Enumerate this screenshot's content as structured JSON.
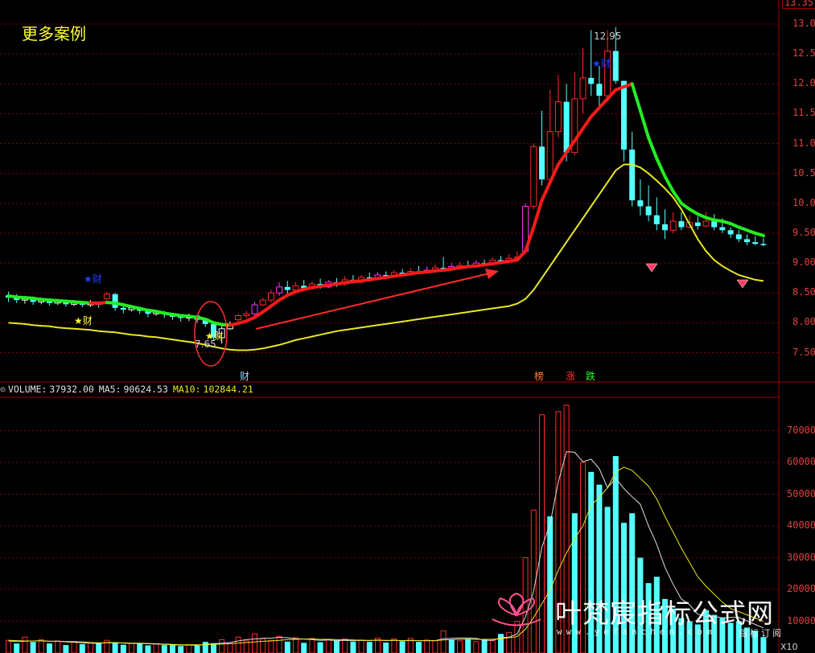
{
  "title": "更多案例",
  "price_axis": {
    "top_label": "13.35",
    "ticks": [
      "13.00",
      "12.50",
      "12.00",
      "11.50",
      "11.00",
      "10.50",
      "10.00",
      "9.50",
      "9.00",
      "8.50",
      "8.00",
      "7.50"
    ],
    "tick_values": [
      13.0,
      12.5,
      12.0,
      11.5,
      11.0,
      10.5,
      10.0,
      9.5,
      9.0,
      8.5,
      8.0,
      7.5
    ]
  },
  "volume_axis": {
    "ticks": [
      "70000",
      "60000",
      "50000",
      "40000",
      "30000",
      "20000",
      "10000"
    ],
    "tick_values": [
      70000,
      60000,
      50000,
      40000,
      30000,
      20000,
      10000
    ],
    "unit_label": "X10"
  },
  "annotations": {
    "high_label": "12.95",
    "low_label": "7.65",
    "cai_markers": [
      "★财",
      "★财"
    ],
    "cai_blue": [
      "★财",
      "★财"
    ],
    "cai_bottom": "财",
    "bottom_tags": [
      "榜",
      "涨",
      "跌"
    ]
  },
  "volume_header": {
    "name": "VOLUME:",
    "volume": "37932.00",
    "ma5_label": "MA5:",
    "ma5": "90624.53",
    "ma10_label": "MA10:",
    "ma10": "102844.21"
  },
  "watermark": {
    "brand": "叶梵宸指标公式网",
    "url": "www.yefanchen.com",
    "sub": "指标订阅"
  },
  "colors": {
    "up": "#ff2a2a",
    "down": "#54ffff",
    "ma_red": "#ff1a1a",
    "ma_green": "#22ee22",
    "ma_yellow": "#e8e821",
    "grid": "#7a0000",
    "axis_text": "#e04040"
  },
  "chart_data": [
    {
      "type": "candlestick",
      "title": "",
      "ylim": [
        7.2,
        13.35
      ],
      "candles": [
        [
          8.46,
          8.42,
          8.52,
          8.35
        ],
        [
          8.42,
          8.38,
          8.48,
          8.33
        ],
        [
          8.38,
          8.4,
          8.45,
          8.32
        ],
        [
          8.4,
          8.35,
          8.44,
          8.3
        ],
        [
          8.35,
          8.38,
          8.42,
          8.31
        ],
        [
          8.38,
          8.33,
          8.41,
          8.29
        ],
        [
          8.33,
          8.36,
          8.4,
          8.3
        ],
        [
          8.36,
          8.31,
          8.39,
          8.27
        ],
        [
          8.31,
          8.34,
          8.38,
          8.28
        ],
        [
          8.34,
          8.3,
          8.37,
          8.26
        ],
        [
          8.3,
          8.34,
          8.38,
          8.27
        ],
        [
          8.34,
          8.3,
          8.36,
          8.25
        ],
        [
          8.4,
          8.48,
          8.52,
          8.38
        ],
        [
          8.48,
          8.25,
          8.5,
          8.2
        ],
        [
          8.25,
          8.22,
          8.28,
          8.16
        ],
        [
          8.22,
          8.25,
          8.29,
          8.19
        ],
        [
          8.25,
          8.2,
          8.27,
          8.15
        ],
        [
          8.2,
          8.15,
          8.22,
          8.09
        ],
        [
          8.15,
          8.18,
          8.22,
          8.12
        ],
        [
          8.18,
          8.14,
          8.2,
          8.08
        ],
        [
          8.14,
          8.1,
          8.16,
          8.05
        ],
        [
          8.1,
          8.08,
          8.13,
          8.02
        ],
        [
          8.08,
          8.12,
          8.15,
          8.03
        ],
        [
          8.12,
          8.05,
          8.14,
          8.0
        ],
        [
          8.05,
          7.98,
          8.08,
          7.93
        ],
        [
          7.98,
          7.75,
          8.0,
          7.7
        ],
        [
          7.75,
          7.9,
          7.95,
          7.65
        ],
        [
          7.9,
          7.98,
          8.02,
          7.88
        ],
        [
          8.05,
          8.12,
          8.15,
          8.02
        ],
        [
          8.12,
          8.15,
          8.2,
          8.08
        ],
        [
          8.15,
          8.3,
          8.35,
          8.12
        ],
        [
          8.3,
          8.38,
          8.42,
          8.28
        ],
        [
          8.38,
          8.5,
          8.55,
          8.34
        ],
        [
          8.5,
          8.6,
          8.68,
          8.45
        ],
        [
          8.6,
          8.55,
          8.7,
          8.48
        ],
        [
          8.55,
          8.62,
          8.68,
          8.5
        ],
        [
          8.62,
          8.58,
          8.72,
          8.55
        ],
        [
          8.58,
          8.65,
          8.7,
          8.55
        ],
        [
          8.65,
          8.6,
          8.74,
          8.57
        ],
        [
          8.6,
          8.68,
          8.72,
          8.58
        ],
        [
          8.68,
          8.65,
          8.75,
          8.6
        ],
        [
          8.65,
          8.72,
          8.78,
          8.62
        ],
        [
          8.72,
          8.7,
          8.8,
          8.66
        ],
        [
          8.7,
          8.76,
          8.8,
          8.66
        ],
        [
          8.76,
          8.74,
          8.84,
          8.7
        ],
        [
          8.74,
          8.8,
          8.85,
          8.72
        ],
        [
          8.8,
          8.78,
          8.86,
          8.74
        ],
        [
          8.78,
          8.84,
          8.88,
          8.76
        ],
        [
          8.84,
          8.82,
          8.9,
          8.78
        ],
        [
          8.82,
          8.86,
          8.92,
          8.8
        ],
        [
          8.86,
          8.85,
          8.95,
          8.82
        ],
        [
          8.85,
          8.88,
          8.94,
          8.83
        ],
        [
          8.88,
          8.92,
          8.98,
          8.85
        ],
        [
          8.92,
          8.9,
          9.1,
          8.86
        ],
        [
          8.9,
          8.94,
          9.0,
          8.87
        ],
        [
          8.94,
          8.96,
          9.02,
          8.9
        ],
        [
          8.96,
          8.95,
          9.04,
          8.92
        ],
        [
          8.95,
          9.0,
          9.05,
          8.93
        ],
        [
          9.0,
          8.98,
          9.06,
          8.95
        ],
        [
          8.98,
          9.05,
          9.1,
          8.96
        ],
        [
          9.05,
          9.02,
          9.12,
          8.98
        ],
        [
          9.02,
          9.08,
          9.15,
          9.0
        ],
        [
          9.08,
          9.1,
          9.2,
          9.04
        ],
        [
          9.2,
          9.95,
          10.0,
          9.15
        ],
        [
          9.95,
          10.95,
          11.0,
          9.9
        ],
        [
          10.95,
          10.4,
          11.55,
          10.3
        ],
        [
          10.4,
          11.2,
          11.9,
          10.35
        ],
        [
          11.2,
          11.7,
          12.15,
          11.1
        ],
        [
          11.7,
          10.85,
          12.0,
          10.7
        ],
        [
          10.85,
          11.75,
          12.2,
          10.8
        ],
        [
          11.75,
          12.1,
          12.6,
          11.5
        ],
        [
          12.1,
          12.0,
          12.9,
          11.8
        ],
        [
          12.0,
          11.8,
          12.3,
          11.6
        ],
        [
          11.8,
          12.55,
          12.9,
          11.7
        ],
        [
          12.55,
          12.05,
          12.95,
          12.0
        ],
        [
          12.05,
          10.9,
          12.05,
          10.7
        ],
        [
          10.9,
          10.05,
          11.2,
          9.95
        ],
        [
          10.05,
          9.95,
          10.4,
          9.8
        ],
        [
          9.95,
          9.8,
          10.3,
          9.7
        ],
        [
          9.8,
          9.65,
          10.1,
          9.55
        ],
        [
          9.65,
          9.55,
          9.9,
          9.4
        ],
        [
          9.55,
          9.7,
          9.85,
          9.5
        ],
        [
          9.7,
          9.6,
          9.85,
          9.55
        ],
        [
          9.6,
          9.68,
          9.8,
          9.58
        ],
        [
          9.68,
          9.62,
          9.78,
          9.56
        ],
        [
          9.62,
          9.7,
          9.85,
          9.6
        ],
        [
          9.7,
          9.6,
          9.82,
          9.55
        ],
        [
          9.6,
          9.55,
          9.75,
          9.5
        ],
        [
          9.55,
          9.48,
          9.6,
          9.42
        ],
        [
          9.48,
          9.4,
          9.55,
          9.35
        ],
        [
          9.4,
          9.35,
          9.48,
          9.3
        ],
        [
          9.35,
          9.32,
          9.45,
          9.3
        ],
        [
          9.32,
          9.3,
          9.42,
          9.28
        ]
      ],
      "ma_fast": [
        8.45,
        8.43,
        8.42,
        8.41,
        8.39,
        8.38,
        8.37,
        8.36,
        8.35,
        8.34,
        8.33,
        8.33,
        8.34,
        8.33,
        8.3,
        8.27,
        8.24,
        8.21,
        8.19,
        8.16,
        8.14,
        8.12,
        8.11,
        8.09,
        8.06,
        8.0,
        7.97,
        7.96,
        7.99,
        8.03,
        8.09,
        8.18,
        8.28,
        8.38,
        8.46,
        8.52,
        8.56,
        8.59,
        8.61,
        8.63,
        8.65,
        8.67,
        8.69,
        8.7,
        8.72,
        8.74,
        8.76,
        8.78,
        8.8,
        8.82,
        8.84,
        8.85,
        8.87,
        8.88,
        8.9,
        8.92,
        8.94,
        8.95,
        8.97,
        8.99,
        9.01,
        9.03,
        9.05,
        9.2,
        9.6,
        10.05,
        10.35,
        10.65,
        10.85,
        11.05,
        11.25,
        11.45,
        11.6,
        11.75,
        11.9,
        11.95,
        12.0,
        11.55,
        11.1,
        10.75,
        10.45,
        10.2,
        10.0,
        9.9,
        9.82,
        9.76,
        9.72,
        9.7,
        9.66,
        9.6,
        9.55,
        9.5,
        9.46
      ],
      "ma_slow": [
        8.0,
        7.99,
        7.98,
        7.96,
        7.95,
        7.94,
        7.92,
        7.91,
        7.9,
        7.89,
        7.88,
        7.86,
        7.85,
        7.84,
        7.82,
        7.8,
        7.79,
        7.77,
        7.76,
        7.74,
        7.72,
        7.7,
        7.68,
        7.66,
        7.63,
        7.6,
        7.57,
        7.55,
        7.54,
        7.54,
        7.55,
        7.57,
        7.6,
        7.63,
        7.67,
        7.71,
        7.74,
        7.77,
        7.8,
        7.83,
        7.86,
        7.88,
        7.9,
        7.92,
        7.94,
        7.96,
        7.98,
        8.0,
        8.02,
        8.04,
        8.06,
        8.08,
        8.1,
        8.12,
        8.14,
        8.16,
        8.18,
        8.2,
        8.22,
        8.24,
        8.26,
        8.28,
        8.32,
        8.4,
        8.55,
        8.75,
        8.95,
        9.15,
        9.35,
        9.55,
        9.75,
        9.95,
        10.15,
        10.35,
        10.55,
        10.65,
        10.65,
        10.6,
        10.5,
        10.38,
        10.25,
        10.1,
        9.9,
        9.65,
        9.4,
        9.2,
        9.05,
        8.95,
        8.87,
        8.8,
        8.76,
        8.72,
        8.7
      ]
    },
    {
      "type": "bar",
      "title": "VOLUME",
      "ylim": [
        0,
        80000
      ],
      "values": [
        4000,
        3000,
        5000,
        3500,
        4200,
        3000,
        3800,
        2500,
        3600,
        2800,
        3200,
        3100,
        4000,
        3400,
        2600,
        3000,
        2900,
        2400,
        2800,
        2500,
        2700,
        2200,
        2600,
        2300,
        3500,
        3100,
        4200,
        3000,
        5000,
        3800,
        6000,
        4500,
        4000,
        5200,
        3600,
        4800,
        3200,
        4600,
        3400,
        4300,
        3800,
        4400,
        3600,
        4100,
        3500,
        4700,
        3300,
        4400,
        3700,
        4600,
        3500,
        4100,
        3900,
        7000,
        4200,
        3800,
        4500,
        3600,
        4300,
        3900,
        6000,
        6500,
        10000,
        30000,
        45000,
        75000,
        43000,
        76000,
        78000,
        44000,
        60000,
        57000,
        53000,
        46000,
        62000,
        41000,
        44000,
        30000,
        22000,
        24000,
        17000,
        14000,
        11000,
        10000,
        9000,
        13500,
        12000,
        11000,
        9500,
        10000,
        8000,
        7000,
        5000
      ],
      "down_flags": [
        0,
        1,
        0,
        1,
        0,
        1,
        0,
        1,
        0,
        1,
        0,
        1,
        0,
        1,
        1,
        0,
        1,
        1,
        0,
        1,
        1,
        1,
        0,
        1,
        1,
        1,
        0,
        0,
        0,
        0,
        0,
        0,
        0,
        0,
        1,
        0,
        1,
        0,
        1,
        0,
        1,
        0,
        1,
        0,
        1,
        0,
        1,
        0,
        1,
        0,
        1,
        0,
        0,
        0,
        1,
        0,
        1,
        0,
        1,
        0,
        1,
        0,
        0,
        0,
        0,
        0,
        1,
        0,
        0,
        1,
        0,
        1,
        1,
        1,
        1,
        1,
        1,
        1,
        1,
        1,
        1,
        1,
        1,
        1,
        1,
        1,
        1,
        1,
        1,
        1,
        1,
        1,
        1
      ],
      "ma5": [
        3800,
        3600,
        3700,
        3800,
        3900,
        3700,
        3700,
        3500,
        3400,
        3200,
        3100,
        3000,
        3300,
        3300,
        3100,
        3000,
        3000,
        2900,
        2800,
        2700,
        2600,
        2500,
        2500,
        2400,
        2700,
        2900,
        3100,
        3300,
        3800,
        4200,
        4400,
        4600,
        4700,
        4900,
        4800,
        4500,
        4400,
        4200,
        4000,
        4100,
        3900,
        4000,
        3900,
        4000,
        3900,
        4100,
        3900,
        4000,
        3900,
        4000,
        3900,
        3900,
        3900,
        4500,
        4600,
        4700,
        4700,
        4600,
        4000,
        4000,
        4800,
        5000,
        6000,
        11400,
        19500,
        33300,
        40600,
        53800,
        63400,
        63200,
        60200,
        61000,
        58000,
        52000,
        55000,
        51800,
        49200,
        46800,
        40000,
        34200,
        27000,
        21600,
        17000,
        15200,
        12200,
        11500,
        11500,
        11100,
        11200,
        11200,
        10100,
        9000,
        7900
      ],
      "ma10": [
        4000,
        3900,
        3800,
        3800,
        3800,
        3700,
        3700,
        3600,
        3600,
        3500,
        3300,
        3200,
        3200,
        3200,
        3200,
        3100,
        3100,
        3000,
        2900,
        2800,
        2700,
        2600,
        2600,
        2600,
        2600,
        2700,
        2800,
        2900,
        3100,
        3300,
        3500,
        3700,
        3800,
        4000,
        4200,
        4300,
        4400,
        4400,
        4300,
        4300,
        4200,
        4200,
        4100,
        4000,
        4000,
        4000,
        4000,
        4000,
        3900,
        3900,
        3900,
        3900,
        3900,
        4100,
        4200,
        4300,
        4300,
        4300,
        4300,
        4300,
        4500,
        4800,
        5200,
        7500,
        11200,
        15500,
        19800,
        26000,
        31500,
        36000,
        40000,
        46500,
        49000,
        52000,
        57000,
        58500,
        57500,
        55000,
        52500,
        48500,
        43000,
        38000,
        33000,
        28500,
        24000,
        21000,
        18500,
        16000,
        14000,
        13000,
        12000,
        11000,
        10000
      ]
    }
  ]
}
